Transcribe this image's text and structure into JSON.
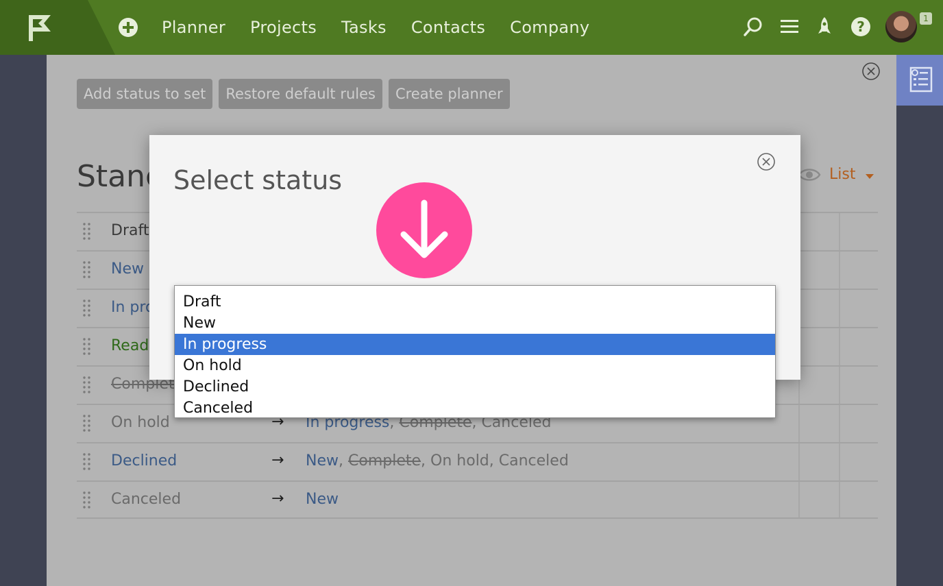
{
  "nav": {
    "items": [
      "Planner",
      "Projects",
      "Tasks",
      "Contacts",
      "Company"
    ],
    "notification_count": "1"
  },
  "toolbar": {
    "add_status": "Add status to set",
    "restore_rules": "Restore default rules",
    "create_planner": "Create planner"
  },
  "page": {
    "title_partial": "Stanc",
    "view_mode": "List"
  },
  "rules": [
    {
      "status": "Draft",
      "style": "draft",
      "targets": []
    },
    {
      "status": "New",
      "style": "new",
      "targets": []
    },
    {
      "status": "In pro",
      "style": "progress",
      "targets": []
    },
    {
      "status": "Ready",
      "style": "ready",
      "targets": []
    },
    {
      "status": "Complete",
      "style": "complete",
      "targets": []
    },
    {
      "status": "On hold",
      "style": "hold",
      "targets": [
        {
          "label": "In progress",
          "style": "progress"
        },
        {
          "label": "Complete",
          "style": "complete"
        },
        {
          "label": "Canceled",
          "style": "canceled"
        }
      ]
    },
    {
      "status": "Declined",
      "style": "declined",
      "targets": [
        {
          "label": "New",
          "style": "new"
        },
        {
          "label": "Complete",
          "style": "complete"
        },
        {
          "label": "On hold",
          "style": "hold"
        },
        {
          "label": "Canceled",
          "style": "canceled"
        }
      ]
    },
    {
      "status": "Canceled",
      "style": "canceled",
      "targets": [
        {
          "label": "New",
          "style": "new"
        }
      ]
    }
  ],
  "modal": {
    "title": "Select status",
    "options": [
      "Draft",
      "New",
      "In progress",
      "On hold",
      "Declined",
      "Canceled"
    ],
    "selected": "In progress"
  },
  "arrow_glyph": "→",
  "colors": {
    "topbar": "#4f7a22",
    "highlight": "#3a76d6",
    "hint": "#ff4a9c",
    "list_link": "#b35f1f"
  }
}
